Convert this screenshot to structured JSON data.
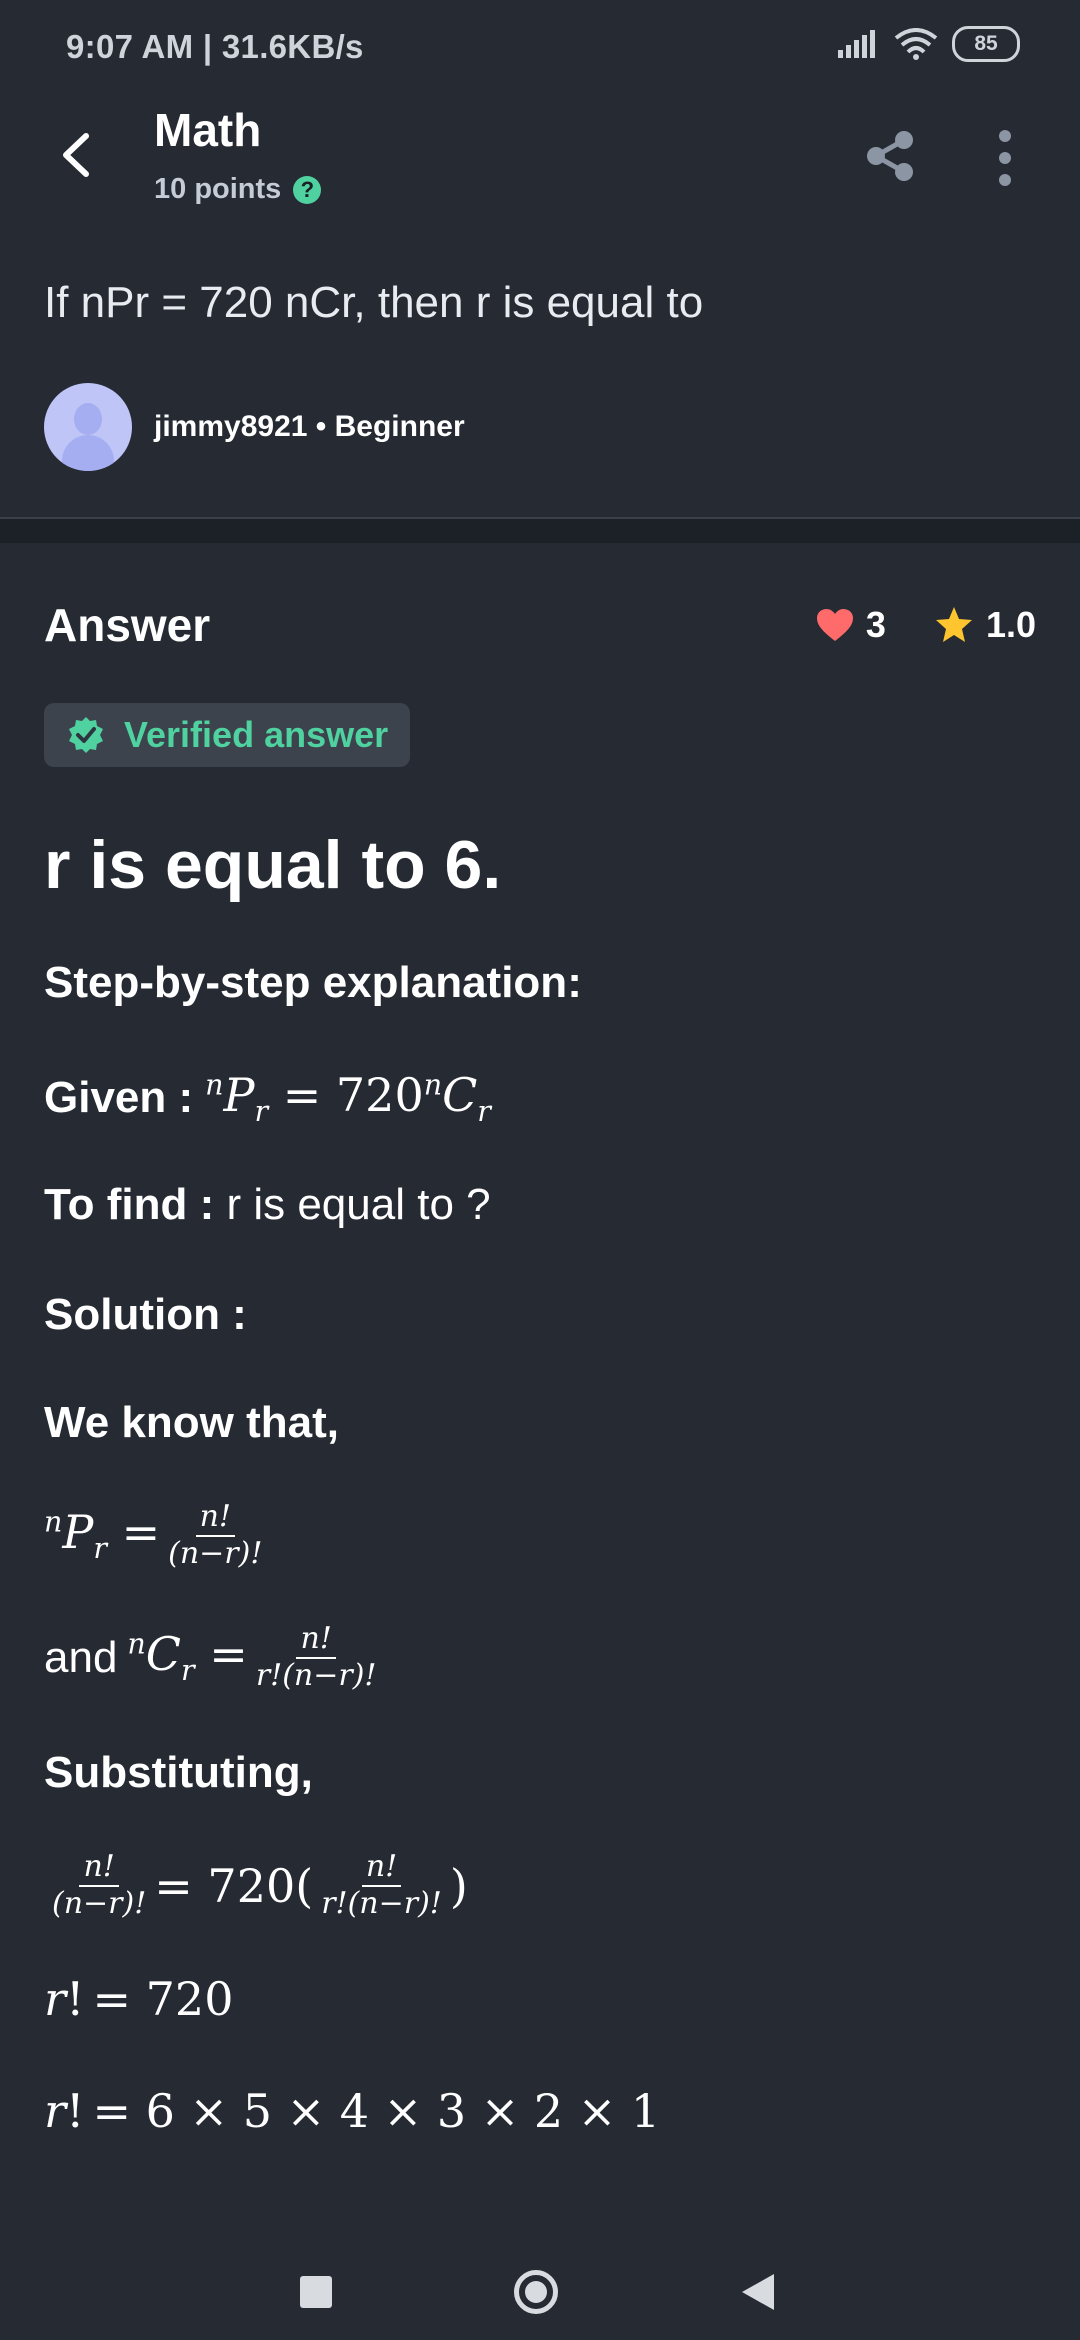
{
  "status_bar": {
    "time": "9:07 AM | 31.6KB/s",
    "battery": "85"
  },
  "header": {
    "title": "Math",
    "points": "10 points",
    "help": "?"
  },
  "question": {
    "text": "If nPr = 720 nCr, then r is equal to",
    "author": "jimmy8921 • Beginner"
  },
  "answer": {
    "label": "Answer",
    "likes": "3",
    "rating": "1.0",
    "verified_label": "Verified answer",
    "headline": "r is equal to 6.",
    "step_heading": "Step-by-step explanation:",
    "given_label": "Given :",
    "to_find_label": "To find :",
    "to_find_text": " r is equal to ?",
    "solution_label": "Solution :",
    "we_know": "We know that,",
    "and_text": "and",
    "substituting": "Substituting,",
    "eq_720": "= 720",
    "eq_factorial": "= 6 × 5 × 4 × 3 × 2 × 1"
  },
  "colors": {
    "background": "#252a33",
    "accent_green": "#4fd1a0",
    "heart": "#ff6b6b",
    "star": "#ffc52e"
  }
}
